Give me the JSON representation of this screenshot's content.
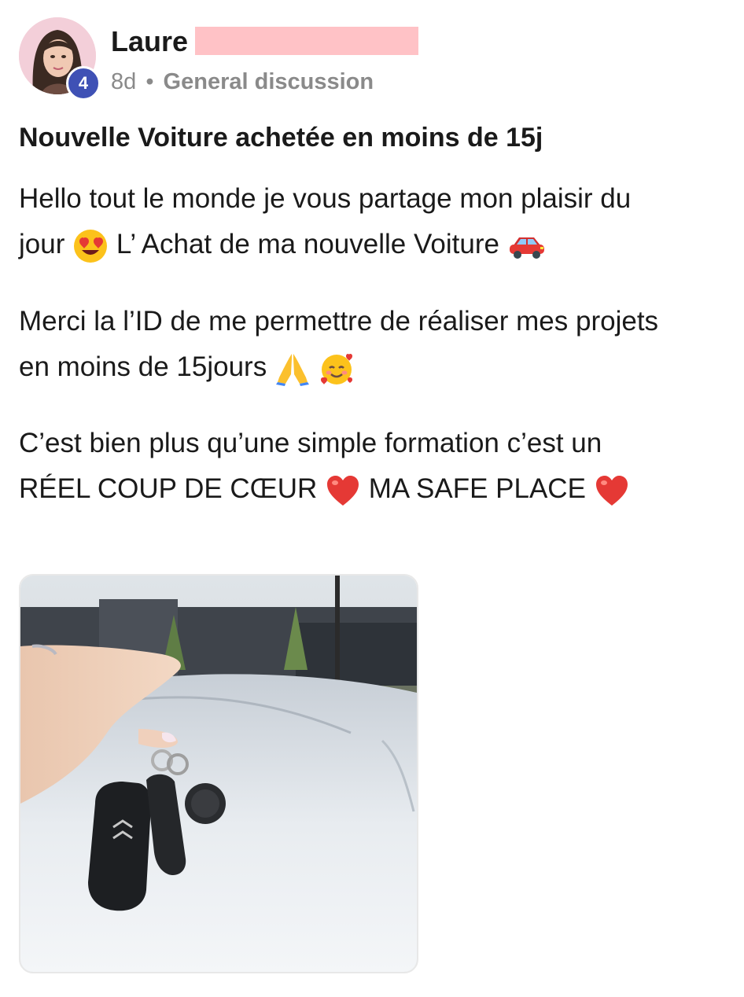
{
  "post": {
    "author": "Laure",
    "level": "4",
    "age": "8d",
    "separator": "•",
    "group": "General discussion",
    "title": "Nouvelle Voiture achetée en moins de 15j",
    "p1_line1": "Hello tout le monde je vous partage mon plaisir du",
    "p1_line2a": "jour",
    "p1_line2b": "L’ Achat de ma nouvelle Voiture",
    "p2_line1": "Merci la l’ID de me permettre de réaliser mes projets",
    "p2_line2": "en moins de 15jours",
    "p3_line1": "C’est bien plus qu’une simple formation c’est un",
    "p3_line2a": "RÉEL COUP DE CŒUR",
    "p3_line2b": "MA SAFE PLACE"
  },
  "icons": {
    "heart_eyes": "smiling-face-with-heart-eyes-icon",
    "car": "car-icon",
    "pray": "folded-hands-icon",
    "hearts_face": "smiling-face-with-hearts-icon",
    "heart": "red-heart-icon"
  },
  "colors": {
    "badge": "#3f51b5",
    "meta": "#8a8a8a",
    "redaction": "#ffc2c6"
  }
}
